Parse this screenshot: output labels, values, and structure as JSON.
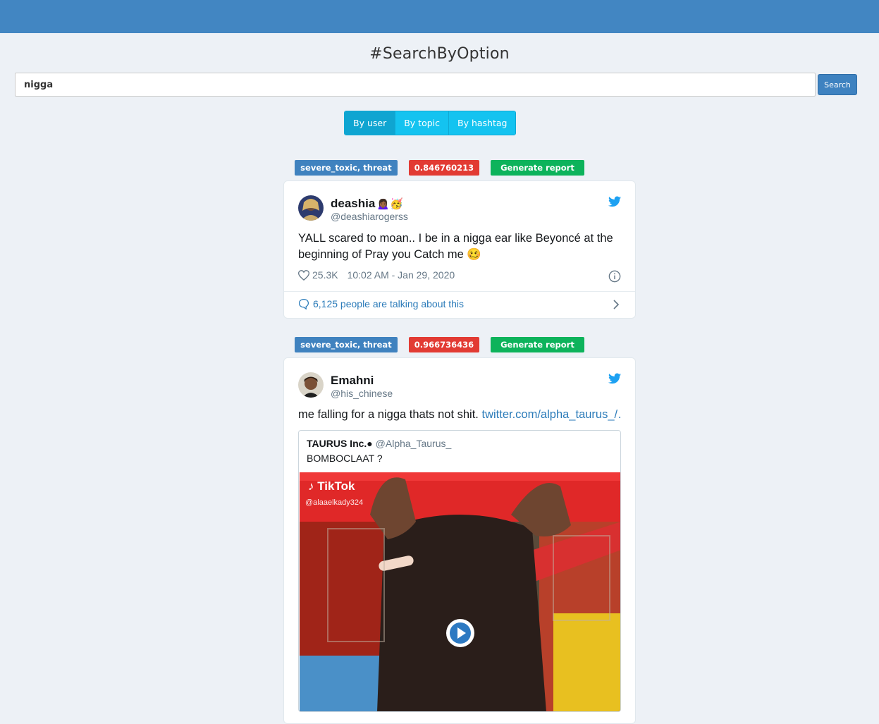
{
  "page": {
    "title": "#SearchByOption"
  },
  "search": {
    "value": "nigga",
    "button_label": "Search"
  },
  "tabs": [
    {
      "label": "By user",
      "active": true
    },
    {
      "label": "By topic",
      "active": false
    },
    {
      "label": "By hashtag",
      "active": false
    }
  ],
  "colors": {
    "header": "#4286c2",
    "primary": "#3e82c0",
    "tab": "#14c3f0",
    "score": "#e23b33",
    "report": "#0db35b",
    "twitter": "#1da1f2"
  },
  "results": [
    {
      "labels": "severe_toxic, threat",
      "score": "0.846760213",
      "report_label": "Generate report",
      "tweet": {
        "name": "deashia",
        "name_emoji": "🙍🏾‍♀️🥳",
        "handle": "@deashiarogerss",
        "text": "YALL scared to moan.. I be in a nigga ear like Beyoncé at the beginning of Pray you Catch me",
        "text_emoji": "🥴",
        "likes": "25.3K",
        "time": "10:02 AM - Jan 29, 2020",
        "talking": "6,125 people are talking about this"
      }
    },
    {
      "labels": "severe_toxic, threat",
      "score": "0.966736436",
      "report_label": "Generate report",
      "tweet": {
        "name": "Emahni",
        "handle": "@his_chinese",
        "text": "me falling for a nigga thats not shit.",
        "link": "twitter.com/alpha_taurus_/…",
        "quote": {
          "name": "TAURUS Inc.●",
          "handle": "@Alpha_Taurus_",
          "text": "BOMBOCLAAT ?",
          "media": {
            "logo_text": "TikTok",
            "watermark": "@alaaelkady324"
          }
        }
      }
    }
  ]
}
